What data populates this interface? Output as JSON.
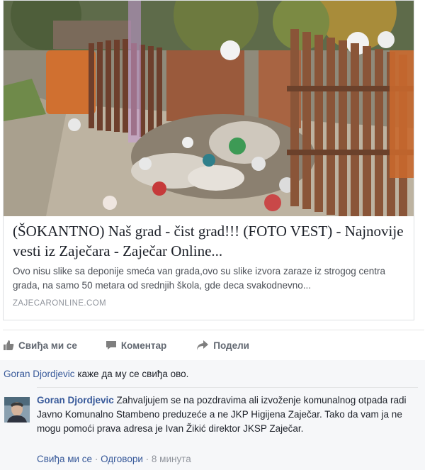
{
  "link_preview": {
    "title": "(ŠOKANTNO) Naš grad - čist grad!!! (FOTO VEST) - Najnovije vesti iz Zaječara - Zaječar Online...",
    "description": "Ovo nisu slike sa deponije smeća van grada,ovo su slike izvora zaraze iz strogog centra grada, na samo 50 metara od srednjih škola, gde deca svakodnevno...",
    "domain": "ZAJECARONLINE.COM"
  },
  "actions": {
    "like_label": "Свиђа ми се",
    "comment_label": "Коментар",
    "share_label": "Подели"
  },
  "likes": {
    "name": "Goran Djordjevic",
    "text": "каже да му се свиђа ово."
  },
  "comment": {
    "author": "Goran Djordjevic",
    "text": "Zahvaljujem se na pozdravima ali izvoženje komunalnog otpada radi Javno Komunalno Stambeno preduzeće a ne JKP Higijena Zaječar. Tako da vam ja ne mogu pomoći prava adresa je Ivan Žikić direktor JKSP Zaječar.",
    "like_label": "Свиђа ми се",
    "reply_label": "Одговори",
    "separator": "·",
    "time": "8 минута"
  },
  "colors": {
    "link_blue": "#365899",
    "action_gray": "#616770",
    "meta_gray": "#90949c",
    "feedback_bg": "#f6f7f9"
  }
}
